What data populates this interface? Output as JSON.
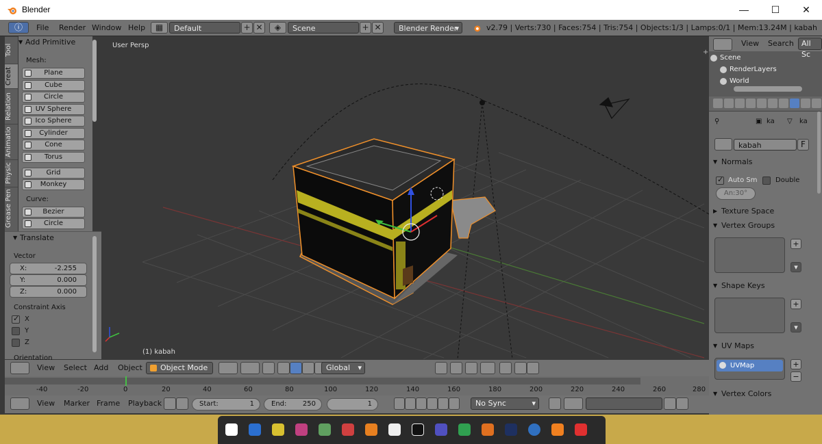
{
  "window": {
    "title": "Blender"
  },
  "menubar": {
    "menus": [
      "File",
      "Render",
      "Window",
      "Help"
    ],
    "layout": "Default",
    "scene": "Scene",
    "engine": "Blender Render",
    "info": "v2.79 | Verts:730 | Faces:754 | Tris:754 | Objects:1/3 | Lamps:0/1 | Mem:13.24M | kabah"
  },
  "toolshelf": {
    "tabs": [
      "Tool",
      "Creat",
      "Relation",
      "Animatio",
      "Physic",
      "Grease Pen"
    ],
    "panel_title": "Add Primitive",
    "mesh_label": "Mesh:",
    "mesh_items": [
      "Plane",
      "Cube",
      "Circle",
      "UV Sphere",
      "Ico Sphere",
      "Cylinder",
      "Cone",
      "Torus"
    ],
    "other_items": [
      "Grid",
      "Monkey"
    ],
    "curve_label": "Curve:",
    "curve_items": [
      "Bezier",
      "Circle"
    ],
    "translate_title": "Translate",
    "vector_label": "Vector",
    "vector": [
      {
        "k": "X:",
        "v": "-2.255"
      },
      {
        "k": "Y:",
        "v": "0.000"
      },
      {
        "k": "Z:",
        "v": "0.000"
      }
    ],
    "constraint_label": "Constraint Axis",
    "constraint": [
      {
        "k": "X",
        "checked": true
      },
      {
        "k": "Y",
        "checked": false
      },
      {
        "k": "Z",
        "checked": false
      }
    ],
    "orientation_label": "Orientation"
  },
  "viewport": {
    "view_label": "User Persp",
    "object_label": "(1) kabah",
    "colors": {
      "bg": "#393939",
      "grid": "#4a4a4a",
      "x_axis": "#8a3a3a",
      "y_axis": "#5a8a3a",
      "select": "#f0902a",
      "trim": "#c8c020"
    }
  },
  "view_header": {
    "menus": [
      "View",
      "Select",
      "Add",
      "Object"
    ],
    "mode": "Object Mode",
    "orientation": "Global"
  },
  "timeline": {
    "ticks": [
      "-60",
      "-20",
      "0",
      "20",
      "40",
      "60",
      "80",
      "100",
      "120",
      "140",
      "160",
      "180",
      "200",
      "220",
      "240",
      "260",
      "280"
    ],
    "tick_extra": "-40",
    "menus": [
      "View",
      "Marker",
      "Frame",
      "Playback"
    ],
    "start_label": "Start:",
    "start": "1",
    "end_label": "End:",
    "end": "250",
    "current": "1",
    "sync": "No Sync"
  },
  "outliner": {
    "menus": [
      "View",
      "Search"
    ],
    "filter": "All Sc",
    "items": [
      "Scene",
      "RenderLayers",
      "World"
    ]
  },
  "properties": {
    "breadcrumb": [
      "ka",
      "ka"
    ],
    "mesh_name": "kabah",
    "fake_user": "F",
    "sections": [
      {
        "name": "Normals",
        "open": true
      },
      {
        "name": "Texture Space",
        "open": false
      },
      {
        "name": "Vertex Groups",
        "open": true
      },
      {
        "name": "Shape Keys",
        "open": true
      },
      {
        "name": "UV Maps",
        "open": true
      },
      {
        "name": "Vertex Colors",
        "open": true
      }
    ],
    "auto_smooth": "Auto Sm",
    "double_sided": "Double",
    "angle": "An:30°",
    "uvmap": "UVMap"
  }
}
